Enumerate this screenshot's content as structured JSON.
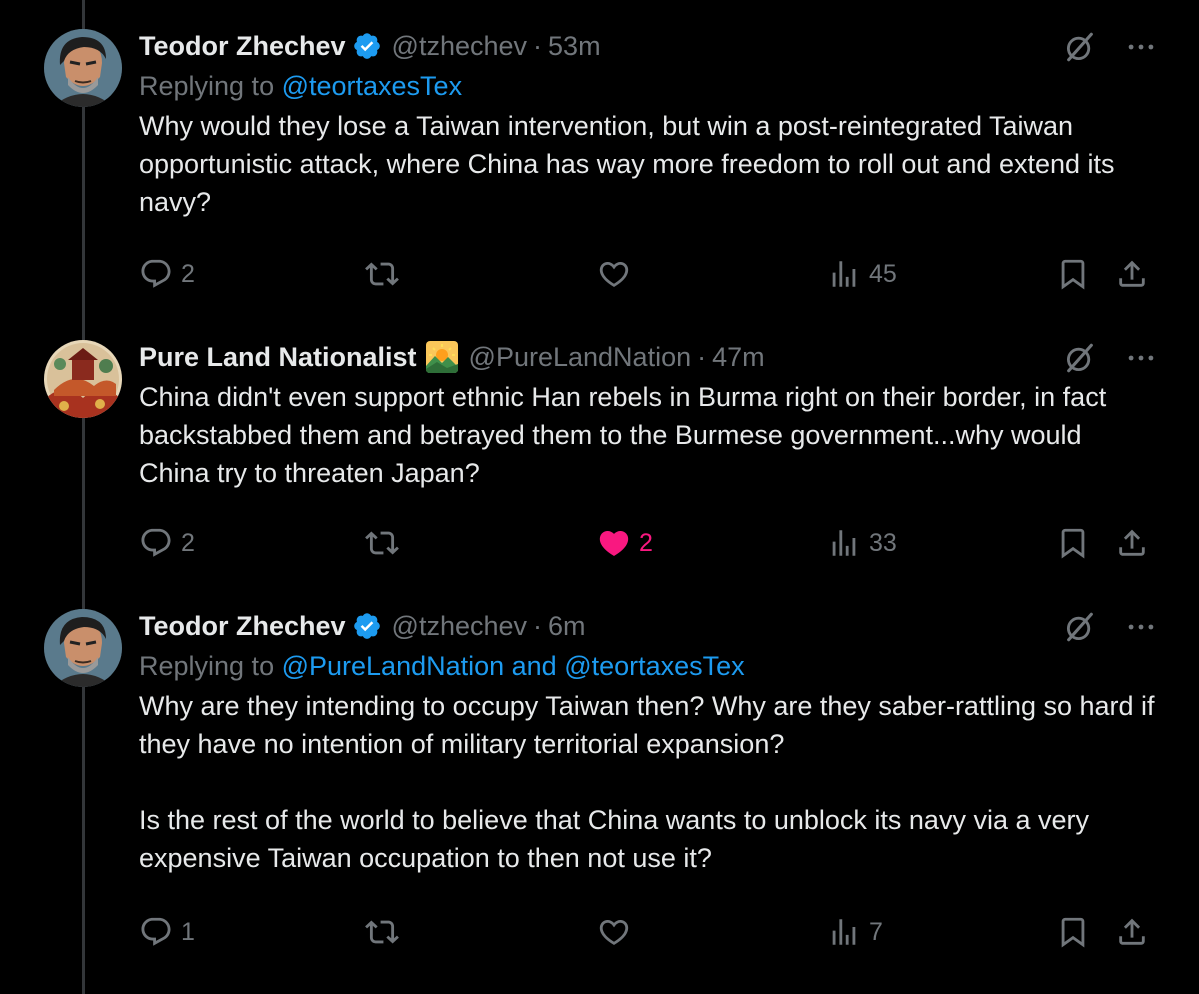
{
  "colors": {
    "background": "#000000",
    "text": "#e7e9ea",
    "secondary": "#71767b",
    "link": "#1d9bf0",
    "verified": "#1d9bf0",
    "like_active": "#f91880"
  },
  "tweets": [
    {
      "name": "Teodor Zhechev",
      "verified": true,
      "handle": "@tzhechev",
      "separator": "·",
      "time": "53m",
      "replying_prefix": "Replying to ",
      "replying_to": "@teortaxesTex",
      "text": [
        "Why would they lose a Taiwan intervention, but win a post-reintegrated Taiwan opportunistic attack, where China has way more freedom to roll out and extend its navy?"
      ],
      "replies": "2",
      "retweets": "",
      "likes": "",
      "views": "45",
      "liked": false
    },
    {
      "name": "Pure Land Nationalist",
      "verified": false,
      "badge_icon": "sunrise-over-mountains-icon",
      "handle": "@PureLandNation",
      "separator": "·",
      "time": "47m",
      "text": [
        "China didn't even support ethnic Han rebels in Burma right on their border, in fact backstabbed them and betrayed them to the Burmese government...why would China try to threaten Japan?"
      ],
      "replies": "2",
      "retweets": "",
      "likes": "2",
      "views": "33",
      "liked": true
    },
    {
      "name": "Teodor Zhechev",
      "verified": true,
      "handle": "@tzhechev",
      "separator": "·",
      "time": "6m",
      "replying_prefix": "Replying to ",
      "replying_to": "@PureLandNation and @teortaxesTex",
      "text": [
        "Why are they intending to occupy Taiwan then? Why are they saber-rattling so hard if they have no intention of military territorial expansion?",
        "Is the rest of the world to believe that China wants to unblock its navy via a very expensive Taiwan occupation to then not use it?"
      ],
      "replies": "1",
      "retweets": "",
      "likes": "",
      "views": "7",
      "liked": false
    }
  ]
}
